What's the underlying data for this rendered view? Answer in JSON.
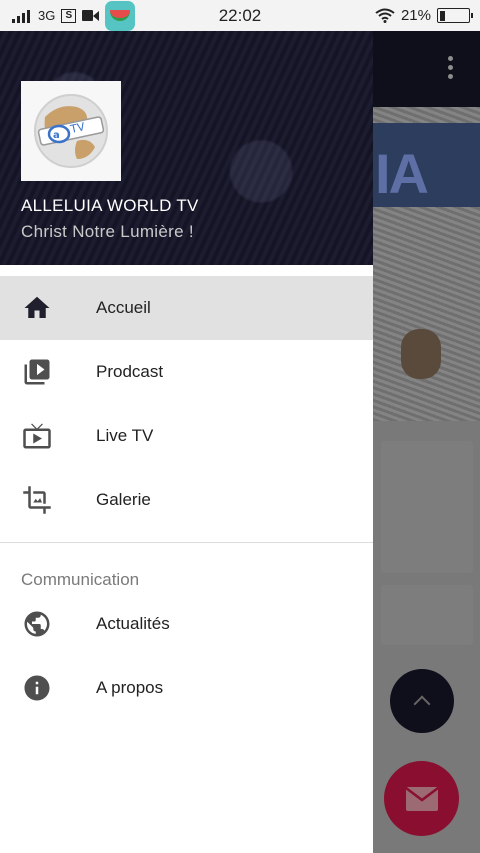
{
  "status_bar": {
    "network": "3G",
    "box_icon_text": "S",
    "time": "22:02",
    "battery": "21%",
    "battery_level": 0.21
  },
  "drawer": {
    "title": "ALLELUIA WORLD TV",
    "subtitle": "Christ Notre Lumière !",
    "items": [
      {
        "label": "Accueil",
        "icon": "home-icon",
        "active": true
      },
      {
        "label": "Prodcast",
        "icon": "playlist-play-icon"
      },
      {
        "label": "Live TV",
        "icon": "live-tv-icon"
      },
      {
        "label": "Galerie",
        "icon": "gallery-icon"
      }
    ],
    "section_title": "Communication",
    "section_items": [
      {
        "label": "Actualités",
        "icon": "globe-icon"
      },
      {
        "label": "A propos",
        "icon": "info-icon"
      }
    ]
  },
  "background": {
    "banner_text": "IA"
  },
  "colors": {
    "header_bg": "#141425",
    "active_item_bg": "#e1e1e1",
    "fab_mail": "#8a0e2f",
    "fab_up": "#0f0f1c",
    "logo_blue": "#3a73c9"
  }
}
